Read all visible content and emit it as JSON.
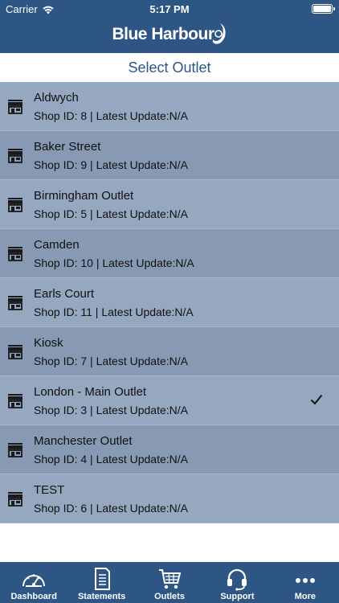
{
  "status_bar": {
    "carrier": "Carrier",
    "time": "5:17 PM"
  },
  "header": {
    "logo_text": "Blue Harbour"
  },
  "page": {
    "title": "Select Outlet"
  },
  "outlets": [
    {
      "name": "Aldwych",
      "meta": "Shop ID: 8 | Latest Update:N/A",
      "selected": false
    },
    {
      "name": "Baker Street",
      "meta": "Shop ID: 9 | Latest Update:N/A",
      "selected": false
    },
    {
      "name": "Birmingham Outlet",
      "meta": "Shop ID: 5 | Latest Update:N/A",
      "selected": false
    },
    {
      "name": "Camden",
      "meta": "Shop ID: 10 | Latest Update:N/A",
      "selected": false
    },
    {
      "name": "Earls Court",
      "meta": "Shop ID: 11 | Latest Update:N/A",
      "selected": false
    },
    {
      "name": "Kiosk",
      "meta": "Shop ID: 7 | Latest Update:N/A",
      "selected": false
    },
    {
      "name": "London - Main Outlet",
      "meta": "Shop ID: 3 | Latest Update:N/A",
      "selected": true
    },
    {
      "name": "Manchester Outlet",
      "meta": "Shop ID: 4 | Latest Update:N/A",
      "selected": false
    },
    {
      "name": "TEST",
      "meta": "Shop ID: 6 | Latest Update:N/A",
      "selected": false
    }
  ],
  "tabs": [
    {
      "label": "Dashboard",
      "icon": "speedometer-icon"
    },
    {
      "label": "Statements",
      "icon": "document-icon"
    },
    {
      "label": "Outlets",
      "icon": "shopping-cart-icon"
    },
    {
      "label": "Support",
      "icon": "headset-icon"
    },
    {
      "label": "More",
      "icon": "more-dots-icon"
    }
  ],
  "colors": {
    "brand": "#2e5684",
    "row_light": "#96a7c0",
    "row_dark": "#8799b3"
  }
}
